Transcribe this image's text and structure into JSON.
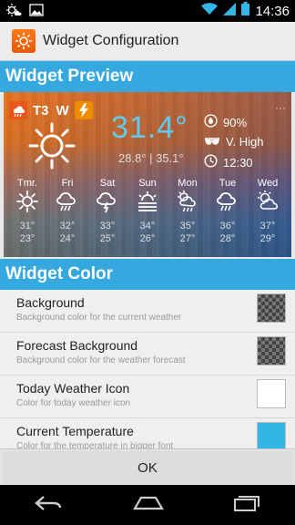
{
  "status_bar": {
    "time": "14:36"
  },
  "app_bar": {
    "title": "Widget Configuration"
  },
  "preview_section": {
    "header": "Widget Preview"
  },
  "widget": {
    "badges": [
      "T3",
      "W"
    ],
    "temperature": "31.4°",
    "hi_lo": "28.8° | 35.1°",
    "humidity": "90%",
    "uv": "V. High",
    "sunrise": "12:30",
    "forecast": [
      {
        "day": "Tmr.",
        "hi": "31°",
        "lo": "23°",
        "icon": "sun-icon"
      },
      {
        "day": "Fri",
        "hi": "32°",
        "lo": "24°",
        "icon": "rain-cloud-icon"
      },
      {
        "day": "Sat",
        "hi": "33°",
        "lo": "25°",
        "icon": "thunder-cloud-icon"
      },
      {
        "day": "Sun",
        "hi": "34°",
        "lo": "26°",
        "icon": "haze-sun-icon"
      },
      {
        "day": "Mon",
        "hi": "35°",
        "lo": "27°",
        "icon": "partly-rain-icon"
      },
      {
        "day": "Tue",
        "hi": "36°",
        "lo": "28°",
        "icon": "rain-cloud-icon"
      },
      {
        "day": "Wed",
        "hi": "37°",
        "lo": "29°",
        "icon": "partly-sunny-icon"
      }
    ]
  },
  "color_section": {
    "header": "Widget Color",
    "items": [
      {
        "title": "Background",
        "subtitle": "Background color for the current weather",
        "swatch": "transparent"
      },
      {
        "title": "Forecast Background",
        "subtitle": "Background color for the weather forecast",
        "swatch": "transparent"
      },
      {
        "title": "Today Weather Icon",
        "subtitle": "Color for today weather icon",
        "swatch": "#ffffff"
      },
      {
        "title": "Current Temperature",
        "subtitle": "Color for the temperature in bigger font",
        "swatch": "#33b5e5"
      }
    ]
  },
  "ok_button": {
    "label": "OK"
  },
  "colors": {
    "accent": "#35a8e0",
    "temp_text": "#5fcbf2",
    "badge": "#e8561a"
  }
}
